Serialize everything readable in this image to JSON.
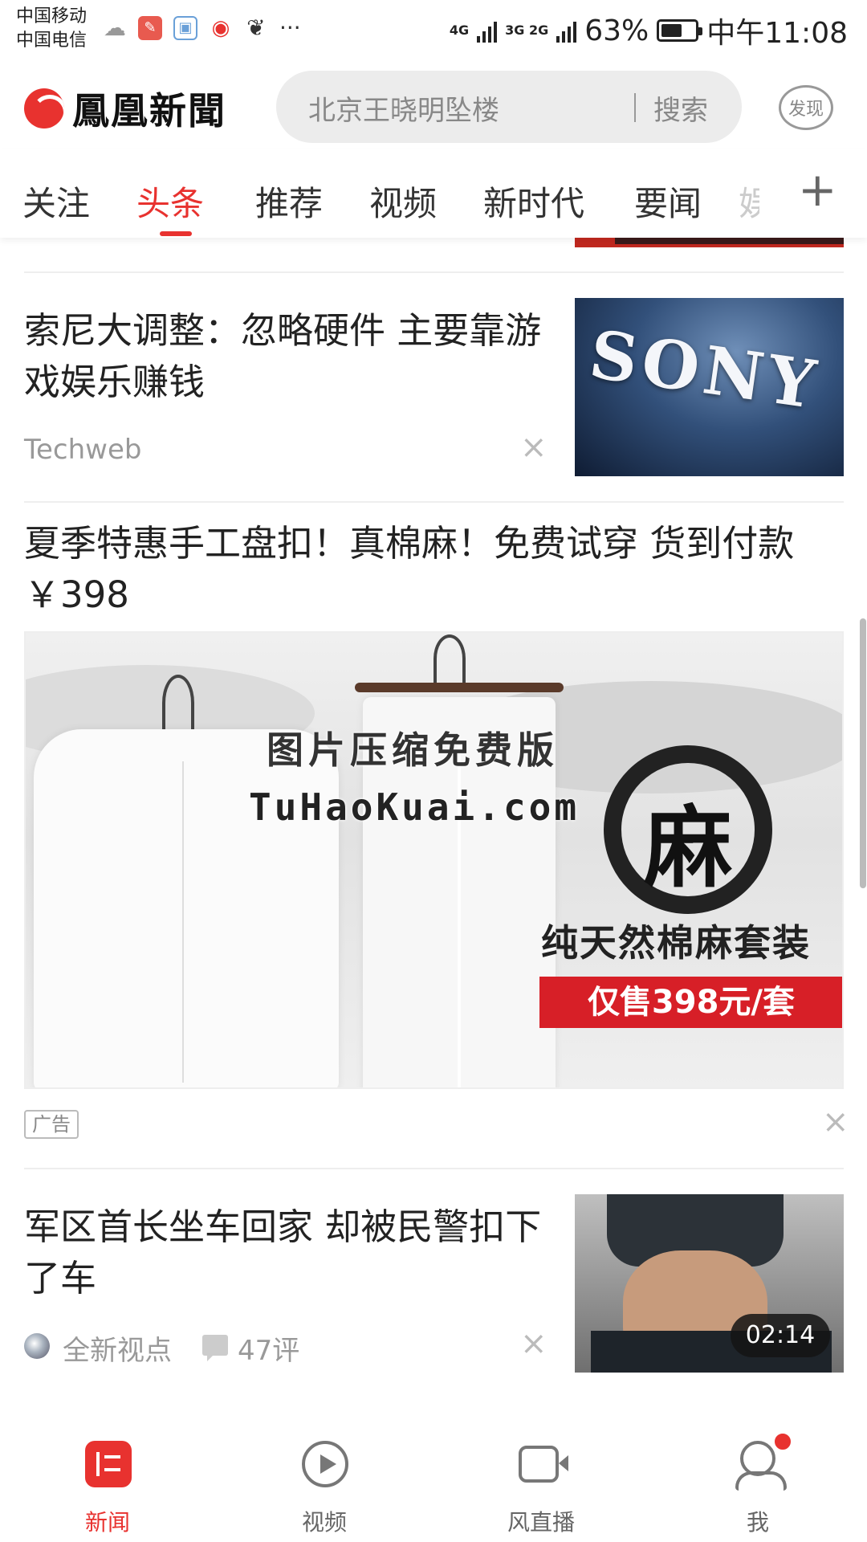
{
  "status_bar": {
    "carrier_1": "中国移动",
    "carrier_2": "中国电信",
    "more": "···",
    "network_1": "4G",
    "network_2": "3G 2G",
    "battery": "63%",
    "battery_level": 0.63,
    "time": "中午11:08"
  },
  "header": {
    "logo": "鳳凰新聞",
    "search_placeholder": "北京王晓明坠楼",
    "search_button": "搜索",
    "discover": "发现"
  },
  "tabs": {
    "items": [
      "关注",
      "头条",
      "推荐",
      "视频",
      "新时代",
      "要闻"
    ],
    "active_index": 1,
    "partial": "娱",
    "add": "+"
  },
  "feed": {
    "article_1": {
      "title": "索尼大调整：忽略硬件 主要靠游戏娱乐赚钱",
      "source": "Techweb",
      "thumb_text": "SONY"
    },
    "ad": {
      "title": "夏季特惠手工盘扣！真棉麻！免费试穿 货到付款￥398",
      "image_char": "麻",
      "image_caption": "纯天然棉麻套装",
      "image_price": "仅售398元/套",
      "watermark_1": "图片压缩免费版",
      "watermark_2": "TuHaoKuai.com",
      "badge": "广告"
    },
    "article_2": {
      "title": "军区首长坐车回家 却被民警扣下了车",
      "source": "全新视点",
      "comments": "47评",
      "duration": "02:14"
    },
    "close_icon": "×"
  },
  "bottom_nav": {
    "items": [
      "新闻",
      "视频",
      "风直播",
      "我"
    ],
    "active_index": 0
  },
  "colors": {
    "accent": "#e8322f",
    "text": "#222222",
    "muted": "#999999"
  }
}
